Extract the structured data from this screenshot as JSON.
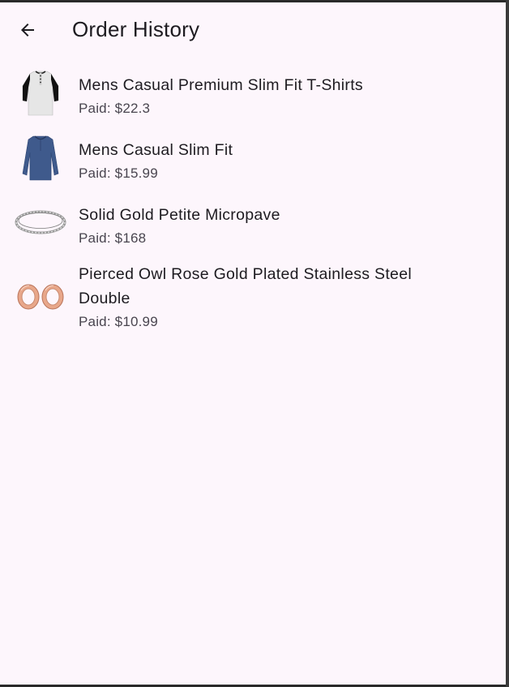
{
  "appbar": {
    "title": "Order History",
    "back_icon": "arrow-left-icon"
  },
  "orders": [
    {
      "name": "Mens Casual Premium Slim Fit T-Shirts",
      "paid": "Paid: $22.3",
      "thumb_icon": "tshirt-raglan-icon"
    },
    {
      "name": "Mens Casual Slim Fit",
      "paid": "Paid: $15.99",
      "thumb_icon": "longsleeve-shirt-icon"
    },
    {
      "name": "Solid Gold Petite Micropave",
      "paid": "Paid: $168",
      "thumb_icon": "bangle-bracelet-icon"
    },
    {
      "name": "Pierced Owl Rose Gold Plated Stainless Steel Double",
      "paid": "Paid: $10.99",
      "thumb_icon": "rose-gold-plugs-icon"
    }
  ],
  "colors": {
    "background": "#fdf6fc",
    "text_primary": "#1d1b20",
    "text_secondary": "#49454f"
  }
}
